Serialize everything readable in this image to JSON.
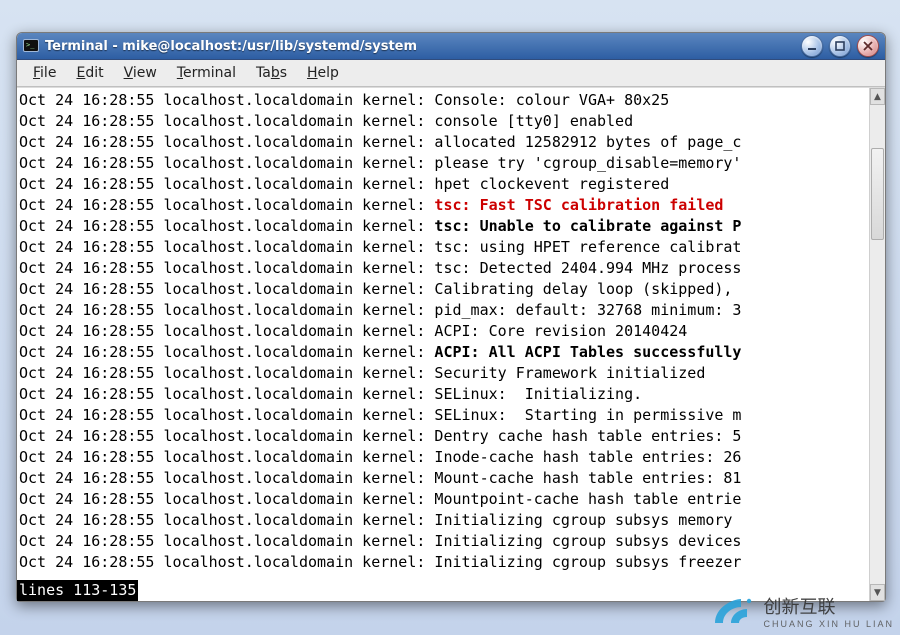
{
  "window": {
    "title": "Terminal - mike@localhost:/usr/lib/systemd/system"
  },
  "menu": {
    "file": {
      "label": "File",
      "hotkey_index": 0
    },
    "edit": {
      "label": "Edit",
      "hotkey_index": 0
    },
    "view": {
      "label": "View",
      "hotkey_index": 0
    },
    "terminal": {
      "label": "Terminal",
      "hotkey_index": 0
    },
    "tabs": {
      "label": "Tabs",
      "hotkey_index": 2
    },
    "help": {
      "label": "Help",
      "hotkey_index": 0
    }
  },
  "log_prefix": "Oct 24 16:28:55 localhost.localdomain kernel: ",
  "log_lines": [
    {
      "text": "Console: colour VGA+ 80x25",
      "style": "normal"
    },
    {
      "text": "console [tty0] enabled",
      "style": "normal"
    },
    {
      "text": "allocated 12582912 bytes of page_c",
      "style": "normal"
    },
    {
      "text": "please try 'cgroup_disable=memory'",
      "style": "normal"
    },
    {
      "text": "hpet clockevent registered",
      "style": "normal"
    },
    {
      "text": "tsc: Fast TSC calibration failed",
      "style": "red"
    },
    {
      "text": "tsc: Unable to calibrate against P",
      "style": "bold"
    },
    {
      "text": "tsc: using HPET reference calibrat",
      "style": "normal"
    },
    {
      "text": "tsc: Detected 2404.994 MHz process",
      "style": "normal"
    },
    {
      "text": "Calibrating delay loop (skipped),",
      "style": "normal"
    },
    {
      "text": "pid_max: default: 32768 minimum: 3",
      "style": "normal"
    },
    {
      "text": "ACPI: Core revision 20140424",
      "style": "normal"
    },
    {
      "text": "ACPI: All ACPI Tables successfully",
      "style": "bold"
    },
    {
      "text": "Security Framework initialized",
      "style": "normal"
    },
    {
      "text": "SELinux:  Initializing.",
      "style": "normal"
    },
    {
      "text": "SELinux:  Starting in permissive m",
      "style": "normal"
    },
    {
      "text": "Dentry cache hash table entries: 5",
      "style": "normal"
    },
    {
      "text": "Inode-cache hash table entries: 26",
      "style": "normal"
    },
    {
      "text": "Mount-cache hash table entries: 81",
      "style": "normal"
    },
    {
      "text": "Mountpoint-cache hash table entrie",
      "style": "normal"
    },
    {
      "text": "Initializing cgroup subsys memory",
      "style": "normal"
    },
    {
      "text": "Initializing cgroup subsys devices",
      "style": "normal"
    },
    {
      "text": "Initializing cgroup subsys freezer",
      "style": "normal"
    }
  ],
  "pager": {
    "status": "lines 113-135"
  },
  "watermark": {
    "text": "创新互联",
    "sub": "CHUANG XIN HU LIAN"
  }
}
